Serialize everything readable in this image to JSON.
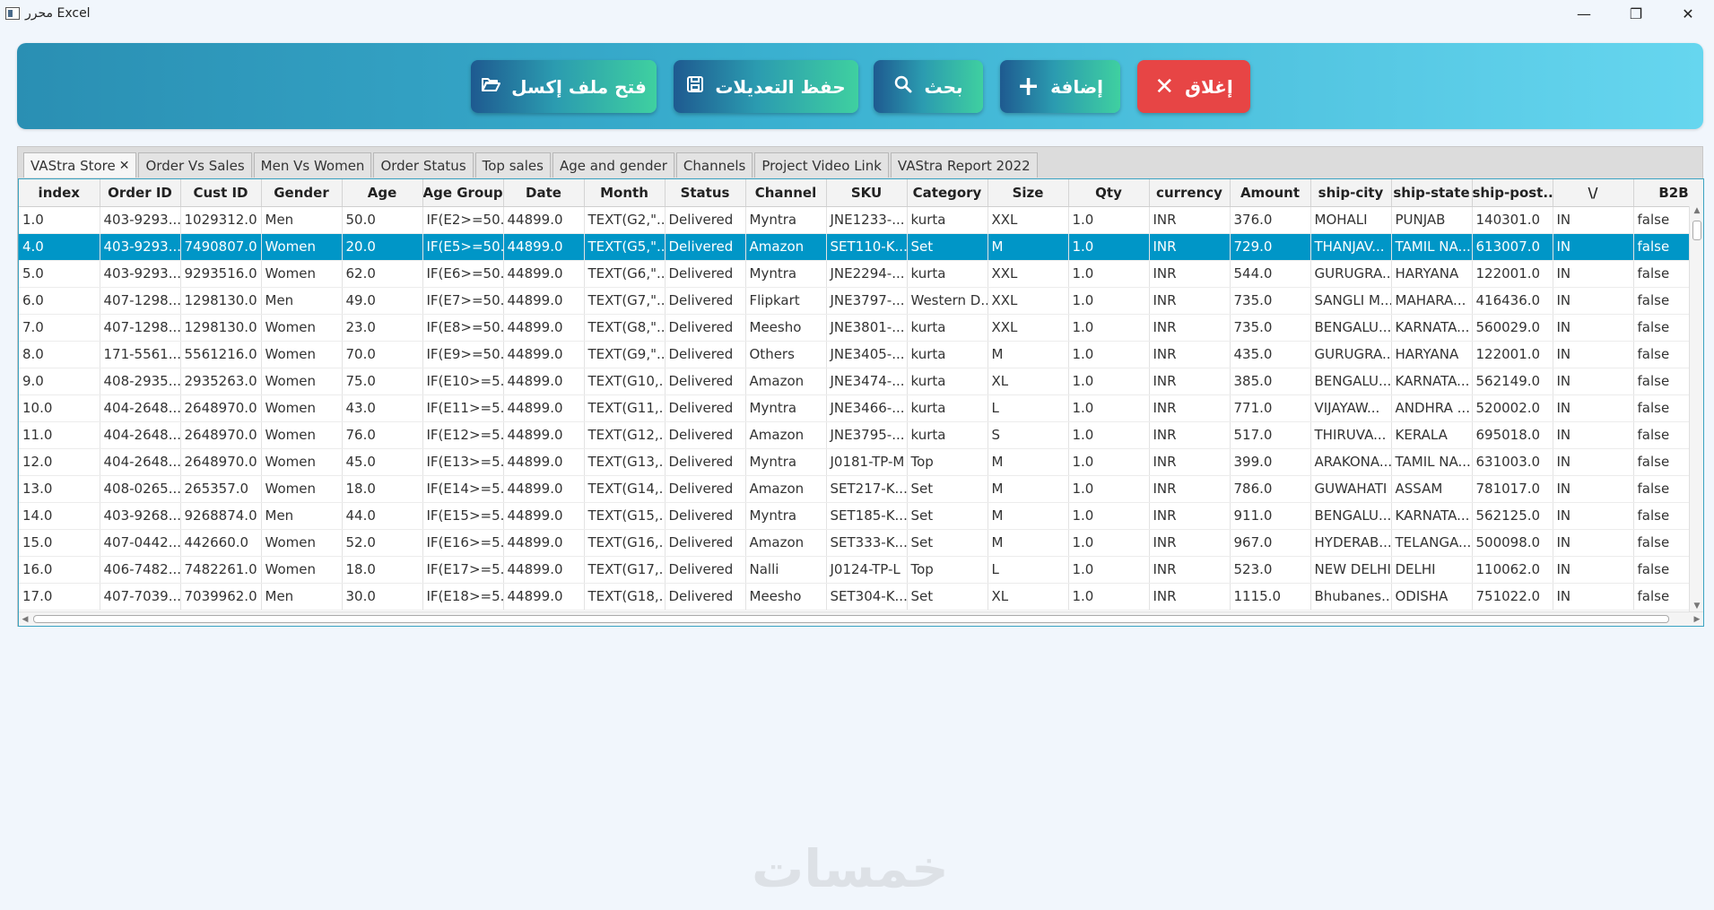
{
  "window": {
    "title": "محرر Excel",
    "minimize": "—",
    "maximize": "❐",
    "close": "✕"
  },
  "toolbar": {
    "open_label": "فتح ملف إكسل",
    "open_icon": "📂",
    "save_label": "حفظ التعديلات",
    "save_icon": "💾",
    "search_label": "بحث",
    "search_icon": "🔍",
    "add_label": "إضافة",
    "add_icon": "+",
    "close_label": "إغلاق",
    "close_icon": "✕"
  },
  "tabs": [
    {
      "label": "VAStra Store",
      "close": "✕"
    },
    {
      "label": "Order Vs Sales"
    },
    {
      "label": "Men Vs Women"
    },
    {
      "label": "Order Status"
    },
    {
      "label": "Top sales"
    },
    {
      "label": "Age and gender"
    },
    {
      "label": "Channels"
    },
    {
      "label": "Project Video Link"
    },
    {
      "label": "VAStra Report 2022"
    }
  ],
  "table": {
    "columns": [
      "index",
      "Order ID",
      "Cust ID",
      "Gender",
      "Age",
      "Age Group",
      "Date",
      "Month",
      "Status",
      "Channel",
      "SKU",
      "Category",
      "Size",
      "Qty",
      "currency",
      "Amount",
      "ship-city",
      "ship-state",
      "ship-post...",
      "\\/",
      "B2B"
    ],
    "selected_row": 1,
    "rows": [
      [
        "1.0",
        "403-9293...",
        "1029312.0",
        "Men",
        "50.0",
        "IF(E2>=50...",
        "44899.0",
        "TEXT(G2,\"...",
        "Delivered",
        "Myntra",
        "JNE1233-...",
        "kurta",
        "XXL",
        "1.0",
        "INR",
        "376.0",
        "MOHALI",
        "PUNJAB",
        "140301.0",
        "IN",
        "false"
      ],
      [
        "4.0",
        "403-9293...",
        "7490807.0",
        "Women",
        "20.0",
        "IF(E5>=50...",
        "44899.0",
        "TEXT(G5,\"...",
        "Delivered",
        "Amazon",
        "SET110-K...",
        "Set",
        "M",
        "1.0",
        "INR",
        "729.0",
        "THANJAV...",
        "TAMIL NA...",
        "613007.0",
        "IN",
        "false"
      ],
      [
        "5.0",
        "403-9293...",
        "9293516.0",
        "Women",
        "62.0",
        "IF(E6>=50...",
        "44899.0",
        "TEXT(G6,\"...",
        "Delivered",
        "Myntra",
        "JNE2294-...",
        "kurta",
        "XXL",
        "1.0",
        "INR",
        "544.0",
        "GURUGRA...",
        "HARYANA",
        "122001.0",
        "IN",
        "false"
      ],
      [
        "6.0",
        "407-1298...",
        "1298130.0",
        "Men",
        "49.0",
        "IF(E7>=50...",
        "44899.0",
        "TEXT(G7,\"...",
        "Delivered",
        "Flipkart",
        "JNE3797-...",
        "Western D...",
        "XXL",
        "1.0",
        "INR",
        "735.0",
        "SANGLI M...",
        "MAHARA...",
        "416436.0",
        "IN",
        "false"
      ],
      [
        "7.0",
        "407-1298...",
        "1298130.0",
        "Women",
        "23.0",
        "IF(E8>=50...",
        "44899.0",
        "TEXT(G8,\"...",
        "Delivered",
        "Meesho",
        "JNE3801-...",
        "kurta",
        "XXL",
        "1.0",
        "INR",
        "735.0",
        "BENGALU...",
        "KARNATA...",
        "560029.0",
        "IN",
        "false"
      ],
      [
        "8.0",
        "171-5561...",
        "5561216.0",
        "Women",
        "70.0",
        "IF(E9>=50...",
        "44899.0",
        "TEXT(G9,\"...",
        "Delivered",
        "Others",
        "JNE3405-...",
        "kurta",
        "M",
        "1.0",
        "INR",
        "435.0",
        "GURUGRA...",
        "HARYANA",
        "122001.0",
        "IN",
        "false"
      ],
      [
        "9.0",
        "408-2935...",
        "2935263.0",
        "Women",
        "75.0",
        "IF(E10>=5...",
        "44899.0",
        "TEXT(G10,...",
        "Delivered",
        "Amazon",
        "JNE3474-...",
        "kurta",
        "XL",
        "1.0",
        "INR",
        "385.0",
        "BENGALU...",
        "KARNATA...",
        "562149.0",
        "IN",
        "false"
      ],
      [
        "10.0",
        "404-2648...",
        "2648970.0",
        "Women",
        "43.0",
        "IF(E11>=5...",
        "44899.0",
        "TEXT(G11,...",
        "Delivered",
        "Myntra",
        "JNE3466-...",
        "kurta",
        "L",
        "1.0",
        "INR",
        "771.0",
        "VIJAYAW...",
        "ANDHRA ...",
        "520002.0",
        "IN",
        "false"
      ],
      [
        "11.0",
        "404-2648...",
        "2648970.0",
        "Women",
        "76.0",
        "IF(E12>=5...",
        "44899.0",
        "TEXT(G12,...",
        "Delivered",
        "Amazon",
        "JNE3795-...",
        "kurta",
        "S",
        "1.0",
        "INR",
        "517.0",
        "THIRUVA...",
        "KERALA",
        "695018.0",
        "IN",
        "false"
      ],
      [
        "12.0",
        "404-2648...",
        "2648970.0",
        "Women",
        "45.0",
        "IF(E13>=5...",
        "44899.0",
        "TEXT(G13,...",
        "Delivered",
        "Myntra",
        "J0181-TP-M",
        "Top",
        "M",
        "1.0",
        "INR",
        "399.0",
        "ARAKONA...",
        "TAMIL NA...",
        "631003.0",
        "IN",
        "false"
      ],
      [
        "13.0",
        "408-0265...",
        "265357.0",
        "Women",
        "18.0",
        "IF(E14>=5...",
        "44899.0",
        "TEXT(G14,...",
        "Delivered",
        "Amazon",
        "SET217-K...",
        "Set",
        "M",
        "1.0",
        "INR",
        "786.0",
        "GUWAHATI",
        "ASSAM",
        "781017.0",
        "IN",
        "false"
      ],
      [
        "14.0",
        "403-9268...",
        "9268874.0",
        "Men",
        "44.0",
        "IF(E15>=5...",
        "44899.0",
        "TEXT(G15,...",
        "Delivered",
        "Myntra",
        "SET185-K...",
        "Set",
        "M",
        "1.0",
        "INR",
        "911.0",
        "BENGALU...",
        "KARNATA...",
        "562125.0",
        "IN",
        "false"
      ],
      [
        "15.0",
        "407-0442...",
        "442660.0",
        "Women",
        "52.0",
        "IF(E16>=5...",
        "44899.0",
        "TEXT(G16,...",
        "Delivered",
        "Amazon",
        "SET333-K...",
        "Set",
        "M",
        "1.0",
        "INR",
        "967.0",
        "HYDERAB...",
        "TELANGA...",
        "500098.0",
        "IN",
        "false"
      ],
      [
        "16.0",
        "406-7482...",
        "7482261.0",
        "Women",
        "18.0",
        "IF(E17>=5...",
        "44899.0",
        "TEXT(G17,...",
        "Delivered",
        "Nalli",
        "J0124-TP-L",
        "Top",
        "L",
        "1.0",
        "INR",
        "523.0",
        "NEW DELHI",
        "DELHI",
        "110062.0",
        "IN",
        "false"
      ],
      [
        "17.0",
        "407-7039...",
        "7039962.0",
        "Men",
        "30.0",
        "IF(E18>=5...",
        "44899.0",
        "TEXT(G18,...",
        "Delivered",
        "Meesho",
        "SET304-K...",
        "Set",
        "XL",
        "1.0",
        "INR",
        "1115.0",
        "Bhubanes...",
        "ODISHA",
        "751022.0",
        "IN",
        "false"
      ]
    ]
  },
  "watermark": "خمسات"
}
